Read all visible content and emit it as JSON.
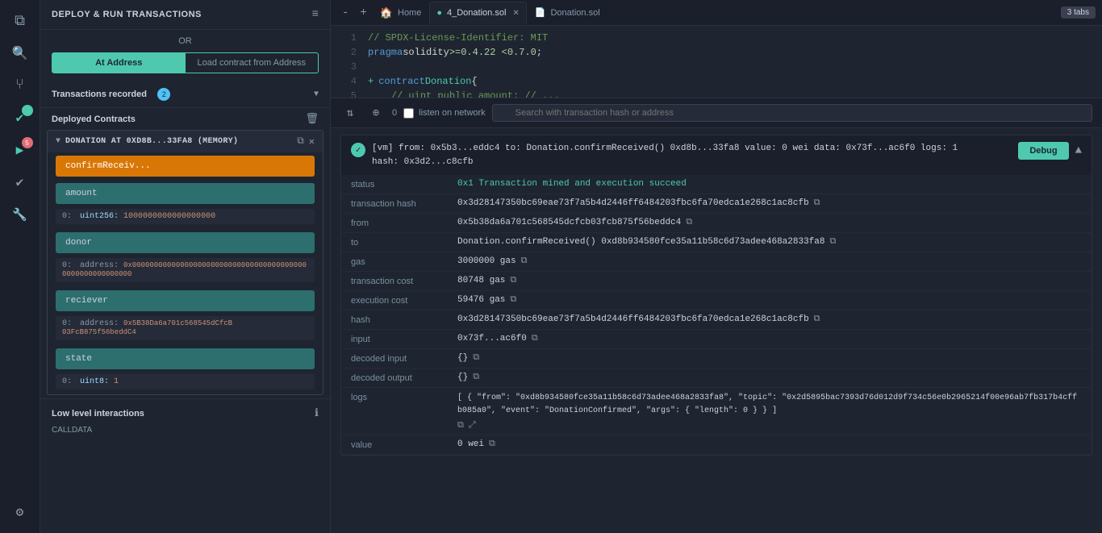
{
  "app": {
    "title": "DEPLOY & RUN TRANSACTIONS"
  },
  "sidebar": {
    "icons": [
      {
        "name": "files-icon",
        "symbol": "⧉",
        "active": false
      },
      {
        "name": "search-icon",
        "symbol": "🔍",
        "active": false
      },
      {
        "name": "git-icon",
        "symbol": "⑂",
        "active": false
      },
      {
        "name": "compile-icon",
        "symbol": "✔",
        "active": true,
        "badge": ""
      },
      {
        "name": "deploy-icon",
        "symbol": "▶",
        "active": false,
        "badge": "5"
      },
      {
        "name": "test-icon",
        "symbol": "✔",
        "active": false
      },
      {
        "name": "tools-icon",
        "symbol": "🔧",
        "active": false
      },
      {
        "name": "settings-icon",
        "symbol": "⚙",
        "active": false
      }
    ]
  },
  "deploy_panel": {
    "title": "DEPLOY & RUN TRANSACTIONS",
    "or_label": "OR",
    "at_address_tab": "At Address",
    "load_contract_tab": "Load contract from Address",
    "transactions_recorded": "Transactions recorded",
    "transactions_count": "2",
    "deployed_contracts": "Deployed Contracts",
    "contract_instance": {
      "name": "DONATION AT 0XD8B...33FA8 (MEMORY)",
      "buttons": [
        {
          "label": "confirmReceiv...",
          "type": "orange"
        },
        {
          "label": "amount",
          "type": "teal"
        },
        {
          "label": "donor",
          "type": "teal"
        },
        {
          "label": "reciever",
          "type": "teal"
        },
        {
          "label": "state",
          "type": "teal"
        }
      ],
      "fields": [
        {
          "button": "amount",
          "output_index": "0:",
          "type": "uint256",
          "value": "1000000000000000000"
        },
        {
          "button": "donor",
          "output_index": "0:",
          "type": "address",
          "value": "0x0000000000000000000000000000000000000000000000000000000000000000"
        },
        {
          "button": "reciever",
          "output_index": "0:",
          "type": "address",
          "value": "0x5B38Da6a701c568545dCfcB03FcB875f56beddC4"
        },
        {
          "button": "state",
          "output_index": "0:",
          "type": "uint8",
          "value": "1"
        }
      ]
    },
    "low_level": {
      "title": "Low level interactions",
      "calldata_label": "CALLDATA"
    }
  },
  "editor": {
    "zoom_in": "+",
    "zoom_out": "-",
    "tabs": [
      {
        "label": "Home",
        "icon": "🏠",
        "active": false,
        "closable": false
      },
      {
        "label": "4_Donation.sol",
        "icon": "📄",
        "active": true,
        "closable": true
      },
      {
        "label": "Donation.sol",
        "icon": "📄",
        "active": false,
        "closable": false
      }
    ],
    "tabs_count": "3 tabs",
    "code_lines": [
      {
        "num": "1",
        "content": "// SPDX-License-Identifier: MIT"
      },
      {
        "num": "2",
        "content": "pragma solidity >=0.4.22 <0.7.0;"
      },
      {
        "num": "3",
        "content": ""
      },
      {
        "num": "4",
        "content": "contract Donation {"
      },
      {
        "num": "5",
        "content": "    uint public amount; // ..."
      }
    ]
  },
  "log": {
    "toolbar": {
      "clear_icon": "↻",
      "filter_icon": "⊕",
      "count": "0",
      "listen_label": "listen on network",
      "search_placeholder": "Search with transaction hash or address"
    },
    "transaction": {
      "status_icon": "✓",
      "summary_line1": "[vm] from: 0x5b3...eddc4 to: Donation.confirmReceived() 0xd8b...33fa8 value: 0 wei data: 0x73f...ac6f0 logs: 1",
      "summary_line2": "hash: 0x3d2...c8cfb",
      "debug_btn": "Debug",
      "details": {
        "status": {
          "key": "status",
          "value": "0x1 Transaction mined and execution succeed"
        },
        "transaction_hash": {
          "key": "transaction hash",
          "value": "0x3d28147350bc69eae73f7a5b4d2446ff6484203fbc6fa70edca1e268c1ac8cfb"
        },
        "from": {
          "key": "from",
          "value": "0x5b38da6a701c568545dcfcb03fcb875f56beddc4"
        },
        "to": {
          "key": "to",
          "value": "Donation.confirmReceived() 0xd8b934580fce35a11b58c6d73adee468a2833fa8"
        },
        "gas": {
          "key": "gas",
          "value": "3000000 gas"
        },
        "transaction_cost": {
          "key": "transaction cost",
          "value": "80748 gas"
        },
        "execution_cost": {
          "key": "execution cost",
          "value": "59476 gas"
        },
        "hash": {
          "key": "hash",
          "value": "0x3d28147350bc69eae73f7a5b4d2446ff6484203fbc6fa70edca1e268c1ac8cfb"
        },
        "input": {
          "key": "input",
          "value": "0x73f...ac6f0"
        },
        "decoded_input": {
          "key": "decoded input",
          "value": "{}"
        },
        "decoded_output": {
          "key": "decoded output",
          "value": "{}"
        },
        "logs": {
          "key": "logs",
          "value": "[ { \"from\": \"0xd8b934580fce35a11b58c6d73adee468a2833fa8\", \"topic\": \"0x2d5895bac7393d76d012d9f734c56e0b2965214f00e96ab7fb317b4cffb085a0\", \"event\": \"DonationConfirmed\", \"args\": { \"length\": 0 } } ]"
        },
        "value": {
          "key": "value",
          "value": "0 wei"
        }
      }
    }
  }
}
